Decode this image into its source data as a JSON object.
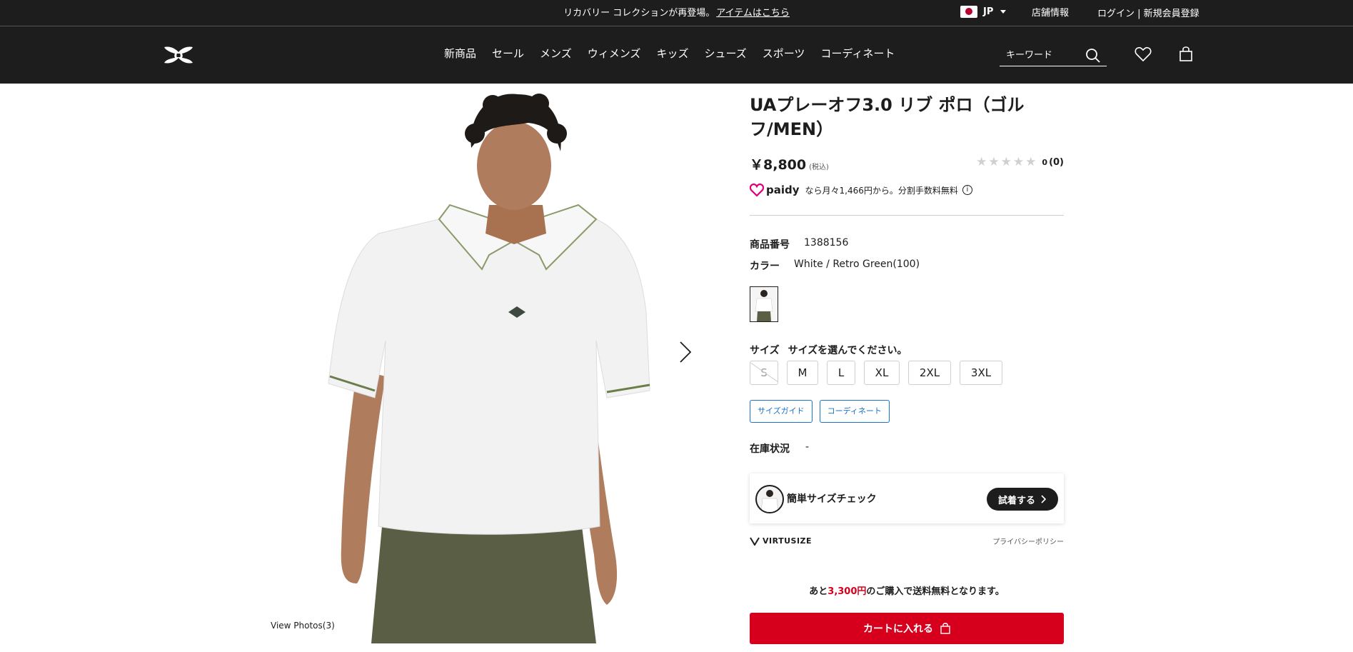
{
  "announcement": {
    "text": "リカバリー コレクションが再登場。",
    "link": "アイテムはこちら"
  },
  "locale": {
    "code": "JP"
  },
  "utility": {
    "stores": "店舗情報",
    "login": "ログイン | 新規会員登録"
  },
  "nav": [
    "新商品",
    "セール",
    "メンズ",
    "ウィメンズ",
    "キッズ",
    "シューズ",
    "スポーツ",
    "コーディネート"
  ],
  "search": {
    "placeholder": "キーワード"
  },
  "product": {
    "title": "UAプレーオフ3.0 リブ ポロ（ゴルフ/MEN）",
    "price": "￥8,800",
    "tax": "(税込)",
    "rating": {
      "stars": 0,
      "count": "0",
      "paren": "(0)"
    },
    "paidy": {
      "brand": "paidy",
      "text": "なら月々1,466円から。分割手数料無料"
    },
    "number_label": "商品番号",
    "number": "1388156",
    "color_label": "カラー",
    "color": "White / Retro Green(100)",
    "size_label": "サイズ",
    "size_prompt": "サイズを選んでください。",
    "sizes": [
      {
        "label": "S",
        "available": false
      },
      {
        "label": "M",
        "available": true
      },
      {
        "label": "L",
        "available": true
      },
      {
        "label": "XL",
        "available": true
      },
      {
        "label": "2XL",
        "available": true
      },
      {
        "label": "3XL",
        "available": true
      }
    ],
    "size_guide": "サイズガイド",
    "coordinate": "コーディネート",
    "stock_label": "在庫状況",
    "stock": "-"
  },
  "virtusize": {
    "title": "簡単サイズチェック",
    "button": "試着する",
    "brand": "VIRTUSIZE",
    "privacy": "プライバシーポリシー"
  },
  "shipping": {
    "prefix": "あと",
    "amount": "3,300円",
    "suffix": "のご購入で送料無料となります。"
  },
  "cart": {
    "label": "カートに入れる"
  },
  "gallery": {
    "view_photos": "View Photos(3)"
  },
  "colors": {
    "header_bg": "#1d1d1d",
    "cart_red": "#d6001c",
    "link_blue": "#1a73c8"
  }
}
